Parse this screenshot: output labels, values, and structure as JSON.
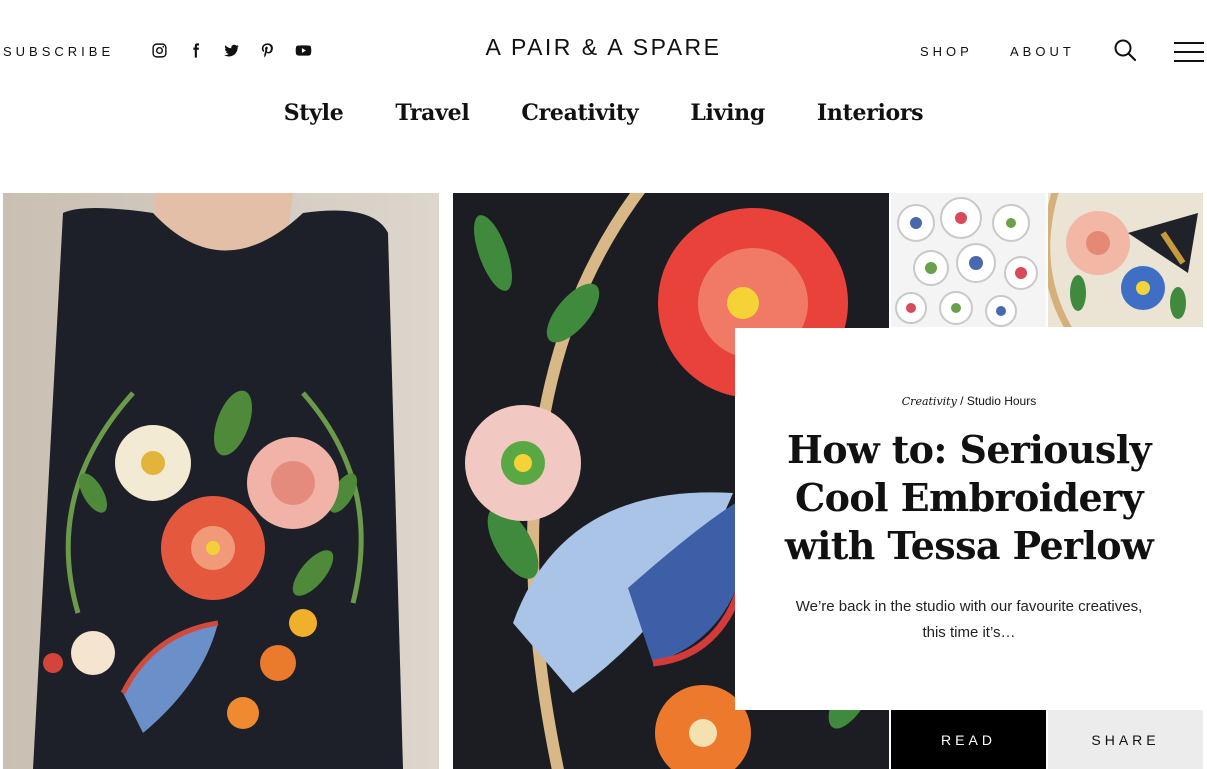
{
  "header": {
    "subscribe_label": "SUBSCRIBE",
    "brand": "A PAIR & A SPARE",
    "shop_label": "SHOP",
    "about_label": "ABOUT",
    "social_icons": [
      "instagram-icon",
      "facebook-icon",
      "twitter-icon",
      "pinterest-icon",
      "youtube-icon"
    ]
  },
  "categories": [
    "Style",
    "Travel",
    "Creativity",
    "Living",
    "Interiors"
  ],
  "feature": {
    "category": "Creativity",
    "separator": "/",
    "subcategory": "Studio Hours",
    "title": "How to: Seriously Cool Embroidery with Tessa Perlow",
    "excerpt": "We’re back in the studio with our favourite creatives, this time it’s…",
    "read_label": "READ",
    "share_label": "SHARE"
  },
  "colors": {
    "text": "#111111",
    "read_button_bg": "#000000",
    "share_button_bg": "#ececec",
    "embroidery_background": "#1b1d22"
  }
}
